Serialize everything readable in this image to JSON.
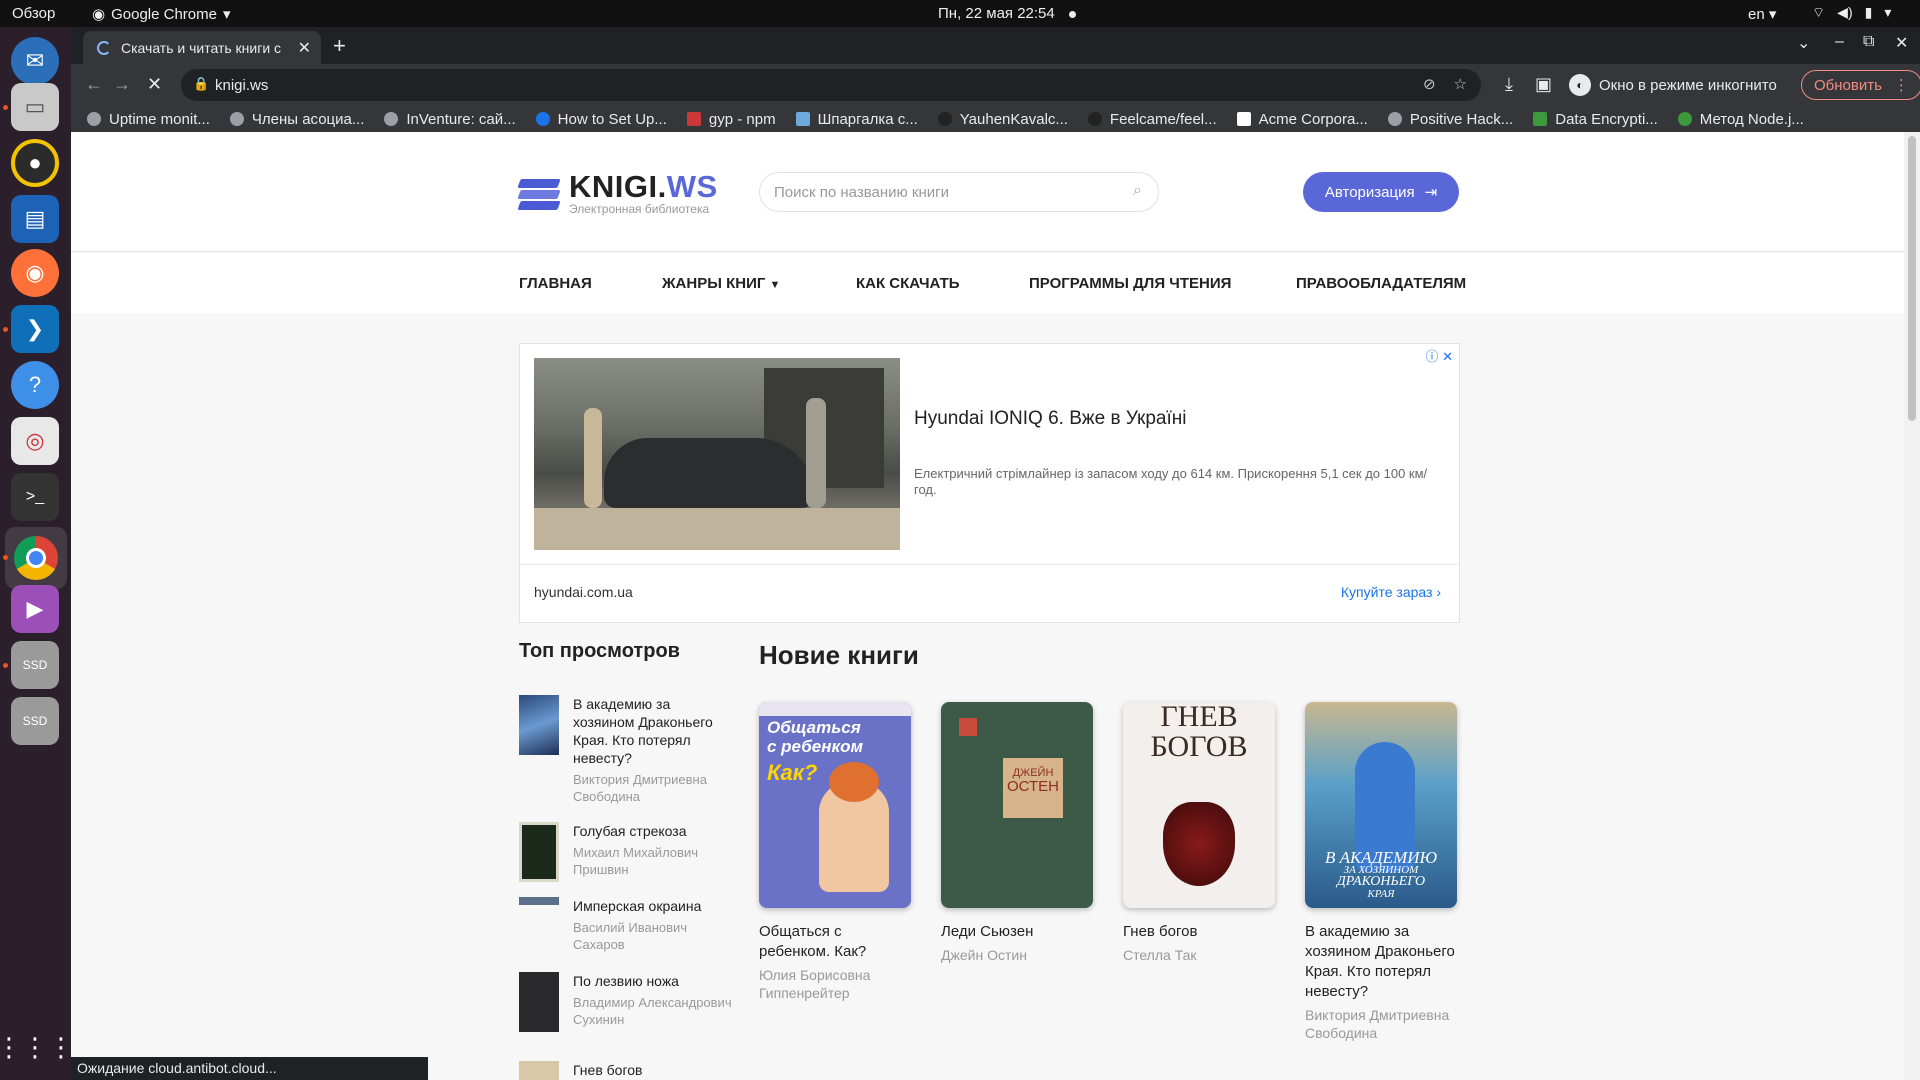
{
  "system": {
    "overview": "Обзор",
    "app_name": "Google Chrome",
    "clock": "Пн, 22 мая  22:54",
    "lang": "en"
  },
  "browser": {
    "tab_title": "Скачать и читать книги с",
    "url": "knigi.ws",
    "incognito_label": "Окно в режиме инкогнито",
    "update_label": "Обновить",
    "bookmarks": [
      "Uptime monit...",
      "Члены асоциа...",
      "InVenture: сай...",
      "How to Set Up...",
      "gyp - npm",
      "Шпаргалка с...",
      "YauhenKavalc...",
      "Feelcame/feel...",
      "Acme Corpora...",
      "Positive Hack...",
      "Data Encrypti...",
      "Метод Node.j..."
    ],
    "status_text": "Ожидание cloud.antibot.cloud..."
  },
  "site": {
    "logo_main": "KNIGI.",
    "logo_accent": "WS",
    "logo_sub": "Электронная библиотека",
    "search_placeholder": "Поиск по названию книги",
    "auth_label": "Авторизация",
    "nav": [
      "Главная",
      "Жанры книг",
      "Как скачать",
      "Программы для чтения",
      "Правообладателям"
    ]
  },
  "ad": {
    "title": "Hyundai IONIQ 6. Вже в Україні",
    "text": "Електричний стрімлайнер із запасом ходу до 614 км. Прискорення 5,1 сек до 100 км/год.",
    "domain": "hyundai.com.ua",
    "cta": "Купуйте зараз"
  },
  "top_views": {
    "title": "Топ просмотров",
    "items": [
      {
        "name": "В академию за хозяином Драконьего Края. Кто потерял невесту?",
        "author": "Виктория Дмитриевна Свободина"
      },
      {
        "name": "Голубая стрекоза",
        "author": "Михаил Михайлович Пришвин"
      },
      {
        "name": "Имперская окраина",
        "author": "Василий Иванович Сахаров"
      },
      {
        "name": "По лезвию ножа",
        "author": "Владимир Александрович Сухинин"
      },
      {
        "name": "Гнев богов",
        "author": ""
      }
    ]
  },
  "new_books": {
    "title": "Новие книги",
    "items": [
      {
        "name": "Общаться с ребенком. Как?",
        "author": "Юлия Борисовна Гиппенрейтер"
      },
      {
        "name": "Леди Сьюзен",
        "author": "Джейн Остин"
      },
      {
        "name": "Гнев богов",
        "author": "Стелла Так"
      },
      {
        "name": "В академию за хозяином Драконьего Края. Кто потерял невесту?",
        "author": "Виктория Дмитриевна Свободина"
      }
    ]
  },
  "covers": {
    "book1_line1": "Общаться",
    "book1_line2": "с ребенком",
    "book1_line3": "Как?",
    "book2_line1": "ДЖЕЙН",
    "book2_line2": "ОСТЕН",
    "book3_line1": "ГНЕВ",
    "book3_line2": "БОГОВ",
    "book4_line1": "В АКАДЕМИЮ",
    "book4_line2": "ЗА ХОЗЯИНОМ",
    "book4_line3": "ДРАКОНЬЕГО",
    "book4_line4": "КРАЯ"
  }
}
